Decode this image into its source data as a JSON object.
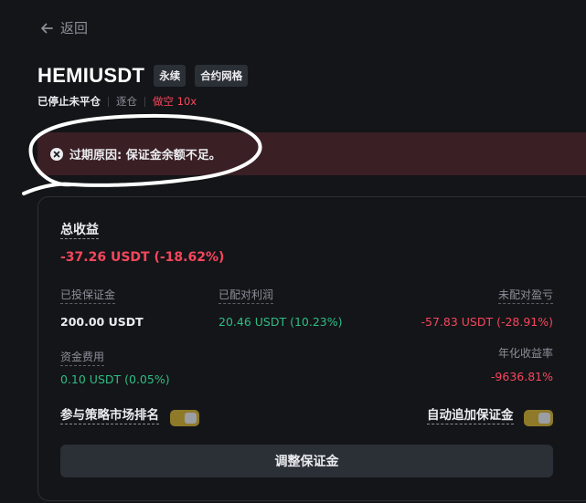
{
  "nav": {
    "back_label": "返回"
  },
  "header": {
    "title": "HEMIUSDT",
    "tags": [
      "永续",
      "合约网格"
    ],
    "status": "已停止未平仓",
    "margin_mode": "逐仓",
    "direction": "做空 10x"
  },
  "alert": {
    "text": "过期原因: 保证金余额不足。"
  },
  "summary": {
    "total_label": "总收益",
    "total_value": "-37.26 USDT (-18.62%)",
    "invested_label": "已投保证金",
    "invested_value": "200.00 USDT",
    "matched_label": "已配对利润",
    "matched_value": "20.46 USDT (10.23%)",
    "unmatched_label": "未配对盈亏",
    "unmatched_value": "-57.83 USDT (-28.91%)",
    "funding_label": "资金费用",
    "funding_value": "0.10 USDT (0.05%)",
    "apr_label": "年化收益率",
    "apr_value": "-9636.81%"
  },
  "toggles": {
    "ranking_label": "参与策略市场排名",
    "auto_margin_label": "自动追加保证金"
  },
  "actions": {
    "adjust_margin": "调整保证金"
  },
  "colors": {
    "positive": "#2ebd85",
    "negative": "#f6465d",
    "toggle_on": "#8f7a2a"
  },
  "icons": [
    "arrow-left-icon",
    "close-circle-icon"
  ]
}
